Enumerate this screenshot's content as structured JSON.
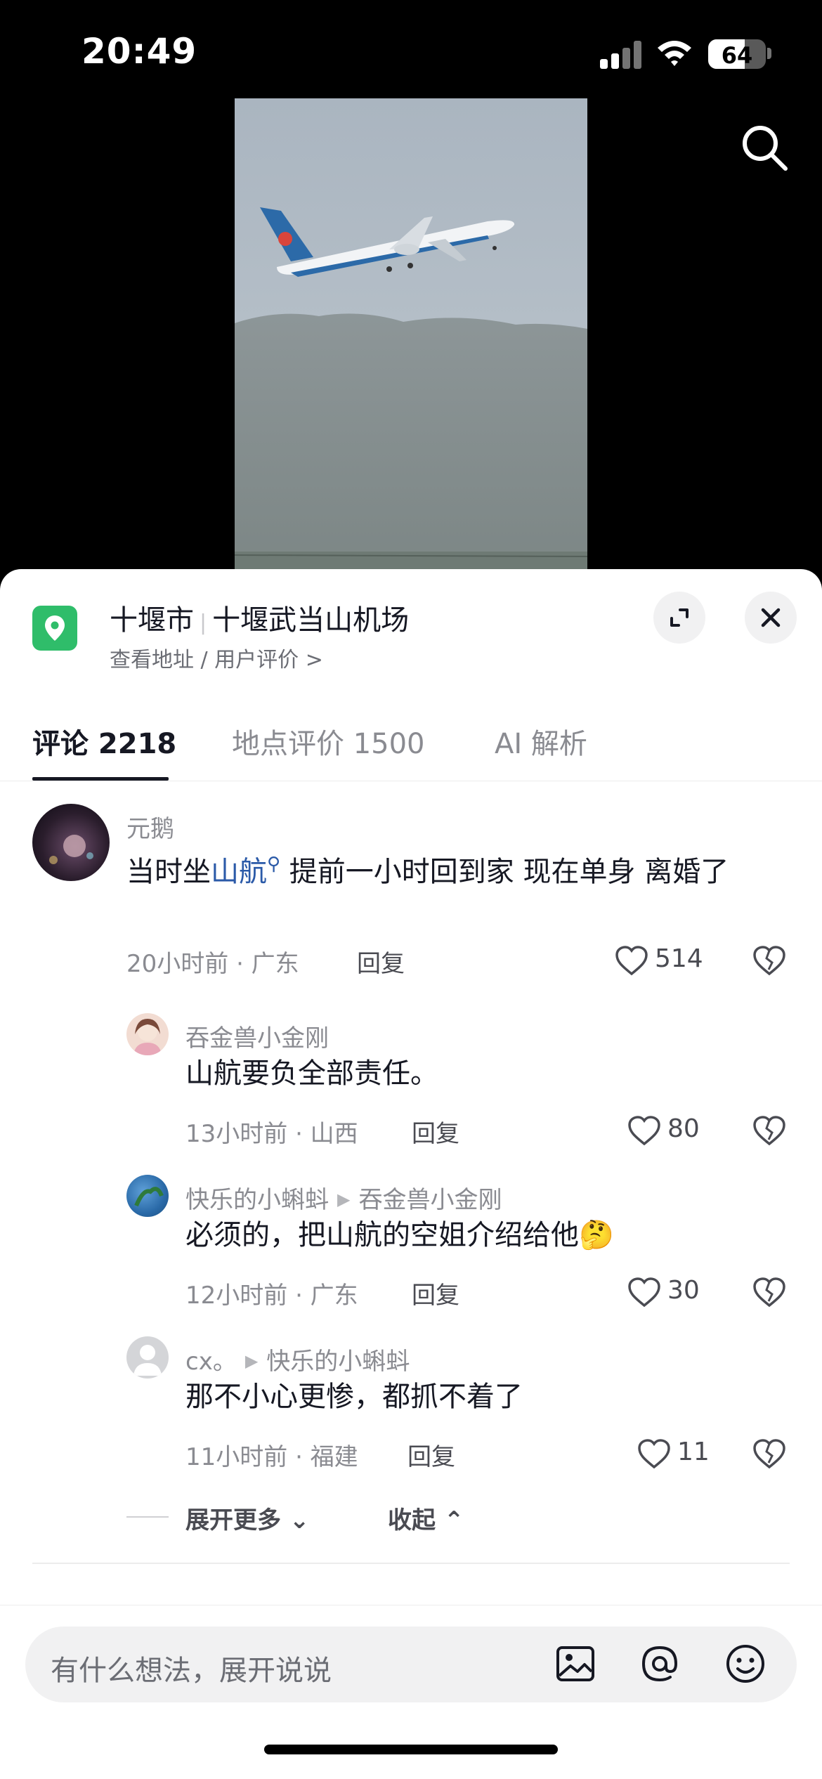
{
  "status_bar": {
    "time": "20:49",
    "battery": "64",
    "battery_level": 0.64
  },
  "video": {
    "search_icon": "search-icon"
  },
  "location": {
    "city": "十堰市",
    "place": "十堰武当山机场",
    "sub_link": "查看地址 / 用户评价 >",
    "icon": "map-pin-icon"
  },
  "tabs": [
    {
      "label": "评论 2218",
      "active": true
    },
    {
      "label": "地点评价 1500",
      "active": false
    },
    {
      "label": "AI 解析",
      "active": false
    }
  ],
  "comments": [
    {
      "user": "元鹅",
      "text_before": "当时坐",
      "text_link": "山航",
      "text_after": " 提前一小时回到家 现在单身 离婚了",
      "meta": "20小时前 · 广东",
      "reply": "回复",
      "likes": "514"
    }
  ],
  "replies": [
    {
      "user": "吞金兽小金刚",
      "reply_to": "",
      "text": "山航要负全部责任。",
      "meta": "13小时前 · 山西",
      "reply": "回复",
      "likes": "80"
    },
    {
      "user": "快乐的小蝌蚪",
      "reply_to": "吞金兽小金刚",
      "text": "必须的，把山航的空姐介绍给他",
      "emoji": "🤔",
      "meta": "12小时前 · 广东",
      "reply": "回复",
      "likes": "30"
    },
    {
      "user": "cx。",
      "reply_to": "快乐的小蝌蚪",
      "text": "那不小心更惨，都抓不着了",
      "meta": "11小时前 · 福建",
      "reply": "回复",
      "likes": "11"
    }
  ],
  "expand": {
    "more": "展开更多",
    "collapse": "收起"
  },
  "input": {
    "placeholder": "有什么想法，展开说说"
  },
  "colors": {
    "accent_green": "#2fbd6a",
    "link_blue": "#2b5aa8"
  }
}
